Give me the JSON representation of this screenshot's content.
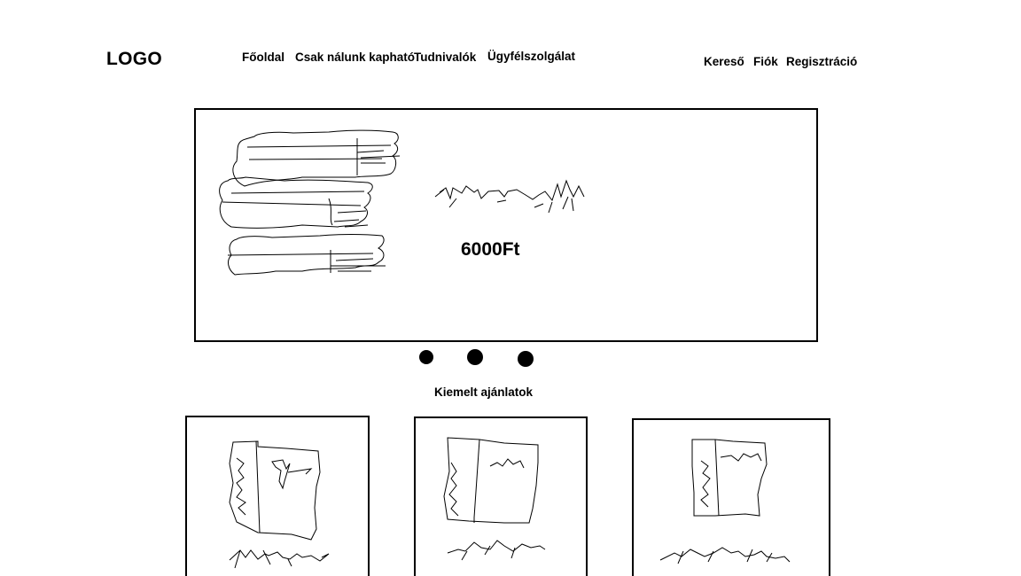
{
  "header": {
    "logo": "LOGO",
    "nav": [
      "Főoldal",
      "Csak nálunk kapható",
      "Tudnivalók",
      "Ügyfélszolgálat"
    ],
    "right_nav": [
      "Kereső",
      "Fiók",
      "Regisztráció"
    ]
  },
  "hero": {
    "price": "6000Ft"
  },
  "carousel": {
    "slide_count": 3
  },
  "featured": {
    "title": "Kiemelt ajánlatok",
    "card_count": 3
  }
}
